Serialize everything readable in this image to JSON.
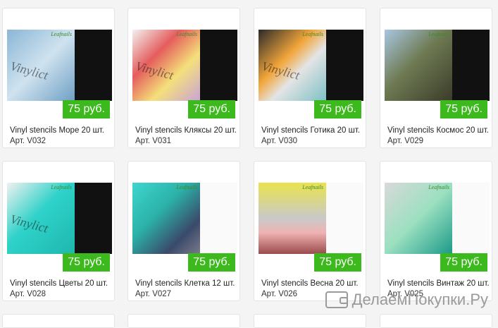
{
  "brand": "Leafnails",
  "currency_label": "75 руб.",
  "products": [
    {
      "title": "Vinyl stencils Море 20 шт.",
      "sku": "Арт. V032",
      "price": "75 руб.",
      "script": "Vinylict"
    },
    {
      "title": "Vinyl stencils Кляксы 20 шт.",
      "sku": "Арт. V031",
      "price": "75 руб.",
      "script": "Vinylict"
    },
    {
      "title": "Vinyl stencils Готика 20 шт.",
      "sku": "Арт. V030",
      "price": "75 руб.",
      "script": "Vinylict"
    },
    {
      "title": "Vinyl stencils Космос 20 шт.",
      "sku": "Арт. V029",
      "price": "75 руб.",
      "script": ""
    },
    {
      "title": "Vinyl stencils Цветы 20 шт.",
      "sku": "Арт. V028",
      "price": "75 руб.",
      "script": "Vinylict"
    },
    {
      "title": "Vinyl stencils Клетка 12 шт.",
      "sku": "Арт. V027",
      "price": "75 руб.",
      "script": ""
    },
    {
      "title": "Vinyl stencils Весна 20 шт.",
      "sku": "Арт. V026",
      "price": "75 руб.",
      "script": ""
    },
    {
      "title": "Vinyl stencils Винтаж 20 шт.",
      "sku": "Арт. V025",
      "price": "75 руб.",
      "script": ""
    }
  ],
  "watermark": "ДелаемПокупки.Ру",
  "colors": {
    "price_bg": "#3cb91d",
    "card_bg": "#ffffff",
    "page_bg": "#f4f4f4"
  }
}
